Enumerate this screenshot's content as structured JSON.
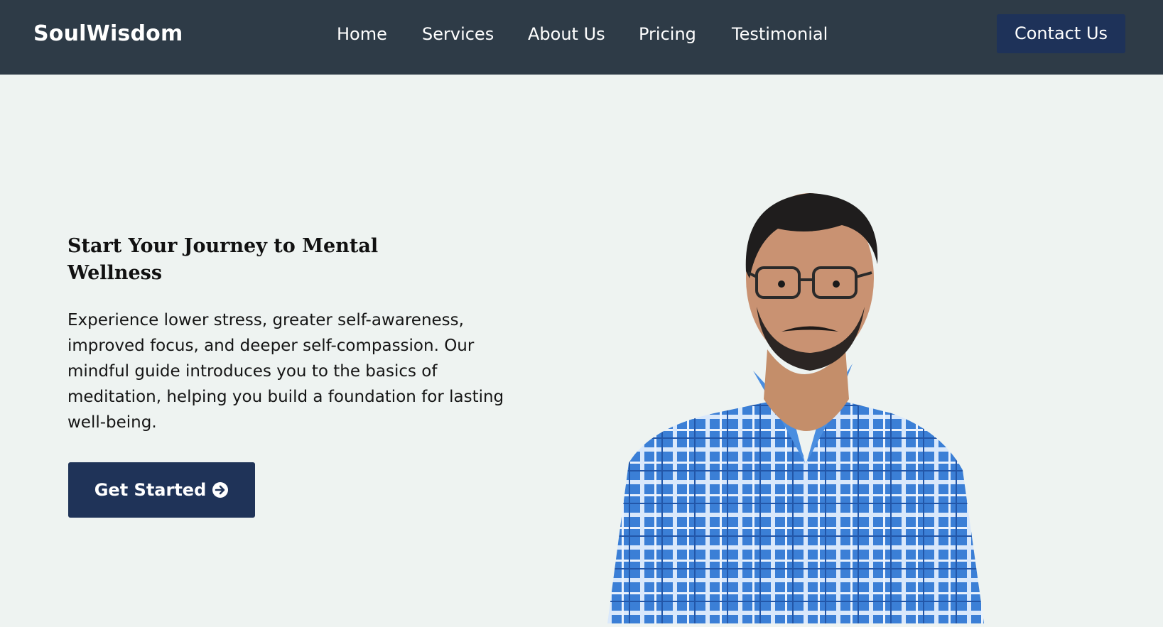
{
  "header": {
    "brand": "SoulWisdom",
    "nav": [
      "Home",
      "Services",
      "About Us",
      "Pricing",
      "Testimonial"
    ],
    "contact_label": "Contact Us"
  },
  "hero": {
    "title": "Start Your Journey to Mental Wellness",
    "description": "Experience lower stress, greater self-awareness, improved focus, and deeper self-compassion. Our mindful guide introduces you to the basics of meditation, helping you build a foundation for lasting well-being.",
    "cta_label": "Get Started",
    "cta_icon": "arrow-right-circle-icon",
    "image": "person-portrait"
  },
  "colors": {
    "nav_bg": "#2e3b47",
    "page_bg": "#eef3f1",
    "button_bg": "#1f3358",
    "shirt_blue": "#3d7fd4"
  }
}
